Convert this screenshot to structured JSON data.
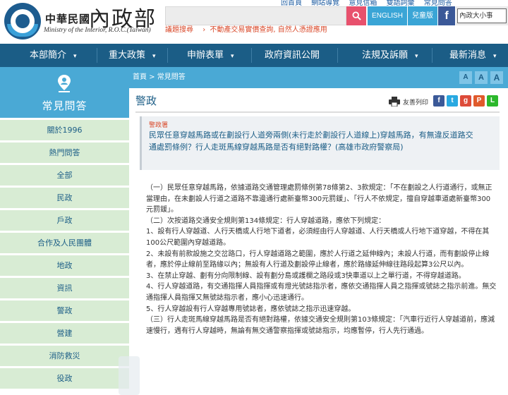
{
  "header": {
    "logo_zh": "中華民國",
    "logo_big": "內政部",
    "logo_en": "Ministry of the Interior, R.O.C.(Taiwan)",
    "top_links": [
      "回首頁",
      "網站導覽",
      "意見信箱",
      "雙語詞彙",
      "常見問答"
    ],
    "search_placeholder": "",
    "search_icon": "search-icon",
    "lang_label": "ENGLISH",
    "access_label": "兒童版",
    "fb_glyph": "f",
    "mini_site": "內政大小事",
    "hot_label": "議題搜尋",
    "hot_arrow": "›",
    "hot_text": "不動產交易實價查詢, 自然人憑證應用",
    "accent_red": "#e8516d",
    "accent_blue": "#3aa5d6"
  },
  "nav": {
    "items": [
      "本部簡介",
      "重大政策",
      "申辦表單",
      "政府資訊公開",
      "法規及訴願",
      "最新消息"
    ],
    "caret": "▾",
    "bar_color": "#1b5d86"
  },
  "breadcrumb": {
    "text": "首頁 > 常見問答"
  },
  "font_sizes": [
    "A",
    "A",
    "A"
  ],
  "sidebar": {
    "title": "常見問答",
    "icon": "faq-person-icon",
    "items": [
      "關於1996",
      "熱門問答",
      "全部",
      "民政",
      "戶政",
      "合作及人民團體",
      "地政",
      "資訊",
      "警政",
      "營建",
      "消防救災",
      "役政"
    ]
  },
  "main": {
    "title": "警政",
    "print_label": "友善列印",
    "share": [
      "f",
      "t",
      "g",
      "P",
      "L"
    ],
    "question_category": "警政署",
    "question": "民眾任意穿越馬路或在劃設行人道旁兩側(未行走於劃設行人道線上)穿越馬路，有無違反道路交通處罰條例？行人走斑馬線穿越馬路是否有絕對路權？(高雄市政府警察局)",
    "answer": [
      "（一）民眾任意穿越馬路，依據道路交通管理處罰條例第78條第2、3款規定：「不在劃設之人行道通行，或無正當理由，在未劃設人行道之道路不靠邊通行處新臺幣300元罰鍰」、「行人不依規定，擅自穿越車道處新臺幣300元罰鍰」。",
      "（二）次按道路交通安全規則第134條規定：行人穿越道路，應依下列規定：",
      "1、設有行人穿越道、人行天橋或人行地下道者，必須經由行人穿越道、人行天橋或人行地下道穿越，不得在其100公尺範圍內穿越道路。",
      "2、未設有前款設施之交岔路口，行人穿越道路之範圍，應於人行道之延伸線內；未設人行道，而有劃設停止線者，應於停止線前至路緣以內；無設有人行道及劃設停止線者，應於路緣延伸線往路段起算3公尺以內。",
      "3、在禁止穿越、劃有分向限制線、設有劃分島或護欄之路段或3快車道以上之單行道，不得穿越道路。",
      "4、行人穿越道路，有交通指揮人員指揮或有燈光號誌指示者，應依交通指揮人員之指揮或號誌之指示前進。無交通指揮人員指揮又無號誌指示者，應小心迅速通行。",
      "5、行人穿越設有行人穿越專用號誌者，應依號誌之指示迅速穿越。",
      "（三）行人走斑馬線穿越馬路是否有絕對路權，依據交通安全規則第103條規定：「汽車行近行人穿越道前，應減速慢行，遇有行人穿越時，無論有無交通警察指揮或號誌指示，均應暫停，行人先行通過。"
    ]
  }
}
